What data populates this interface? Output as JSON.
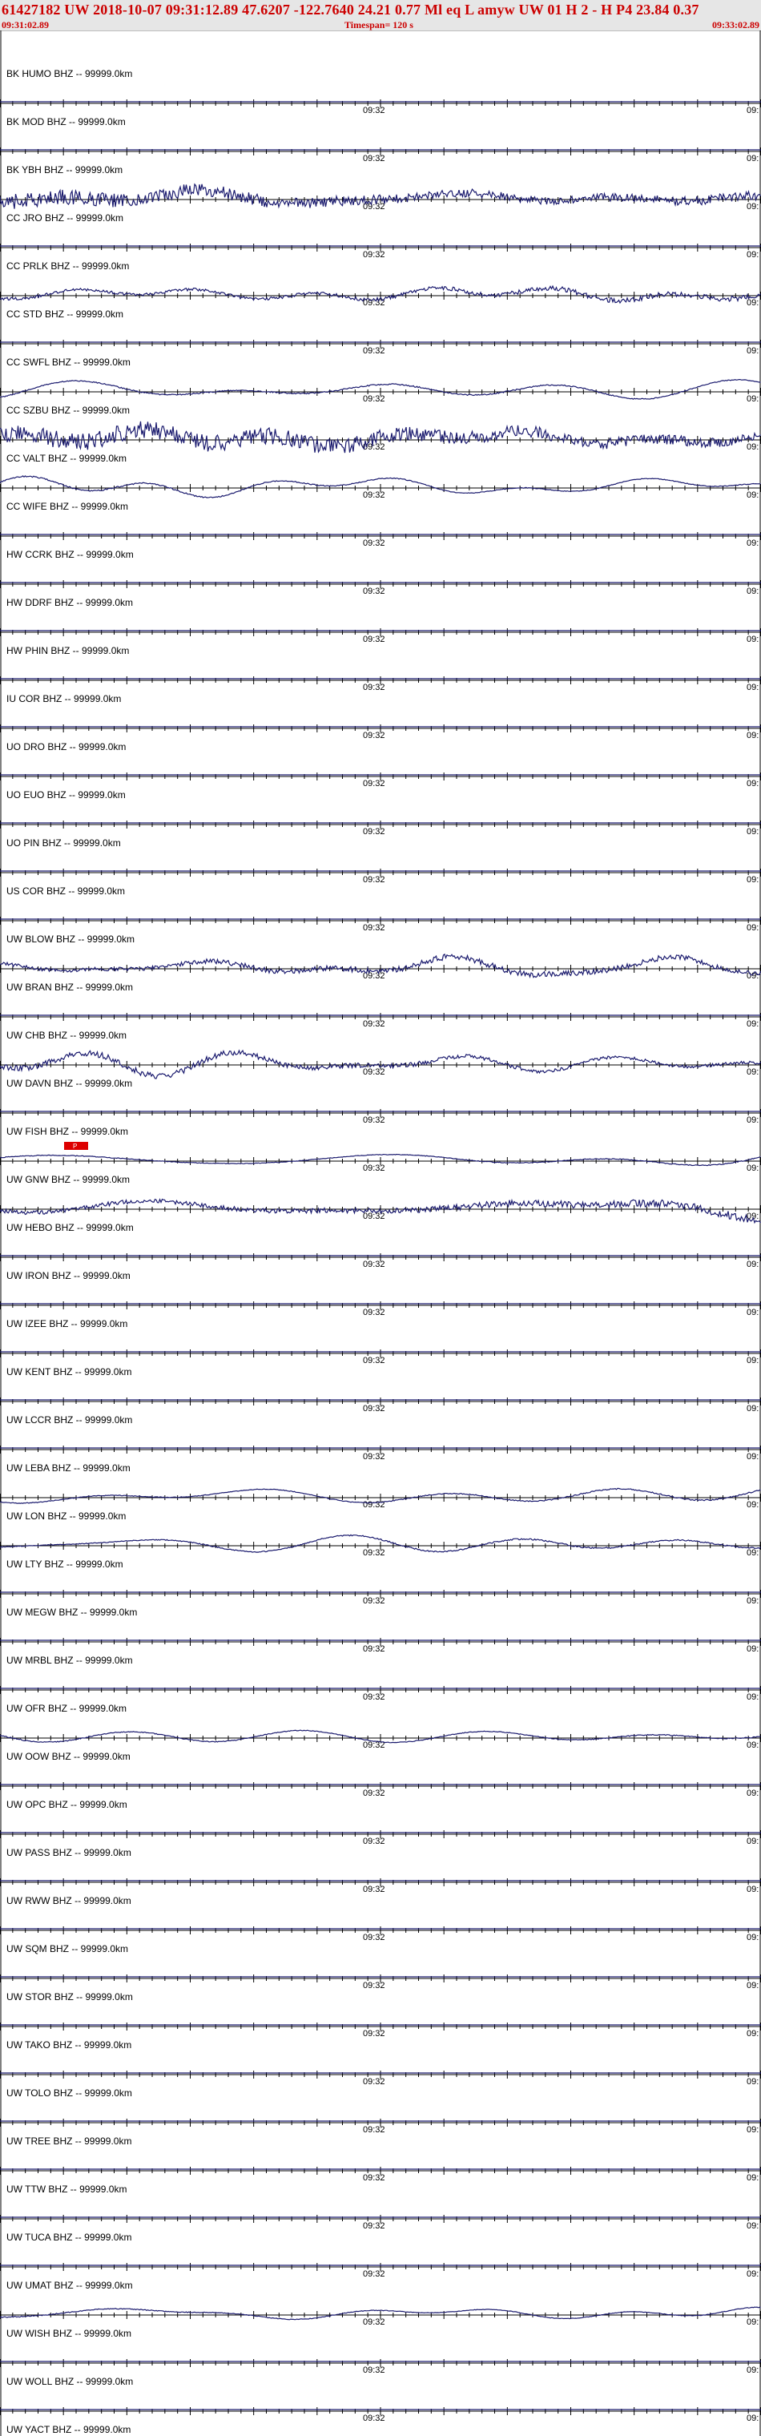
{
  "header": {
    "title": "61427182 UW 2018-10-07 09:31:12.89   47.6207 -122.7640  24.21  0.77 Ml  eq  L amyw     UW 01  H   2  -  H P4   23.84  0.37",
    "start_time": "09:31:02.89",
    "timespan": "Timespan= 120 s",
    "end_time": "09:33:02.89"
  },
  "colors": {
    "trace": "#1a1a6e",
    "axis": "#000000",
    "header_text": "#cc0000",
    "header_bg": "#e6e6e6",
    "pick": "#dd0000"
  },
  "chart_data": {
    "type": "line",
    "title": "",
    "xlabel": "",
    "ylabel": "",
    "time_label": "09:32",
    "time_label_right": "09:",
    "traces": [
      {
        "label": "BK HUMO BHZ -- 99999.0km",
        "shape": "flat",
        "amplitude": 0
      },
      {
        "label": "BK MOD BHZ -- 99999.0km",
        "shape": "flat",
        "amplitude": 0
      },
      {
        "label": "BK YBH BHZ -- 99999.0km",
        "shape": "noisy",
        "amplitude": 0.85
      },
      {
        "label": "CC JRO BHZ -- 99999.0km",
        "shape": "flat",
        "amplitude": 0
      },
      {
        "label": "CC PRLK BHZ -- 99999.0km",
        "shape": "mixed",
        "amplitude": 0.65
      },
      {
        "label": "CC STD BHZ -- 99999.0km",
        "shape": "flat",
        "amplitude": 0
      },
      {
        "label": "CC SWFL BHZ -- 99999.0km",
        "shape": "wave",
        "amplitude": 0.75
      },
      {
        "label": "CC SZBU BHZ -- 99999.0km",
        "shape": "noisy",
        "amplitude": 0.95
      },
      {
        "label": "CC VALT BHZ -- 99999.0km",
        "shape": "wave",
        "amplitude": 0.8
      },
      {
        "label": "CC WIFE BHZ -- 99999.0km",
        "shape": "flat",
        "amplitude": 0
      },
      {
        "label": "HW CCRK BHZ -- 99999.0km",
        "shape": "flat",
        "amplitude": 0
      },
      {
        "label": "HW DDRF BHZ -- 99999.0km",
        "shape": "flat",
        "amplitude": 0
      },
      {
        "label": "HW PHIN BHZ -- 99999.0km",
        "shape": "flat",
        "amplitude": 0
      },
      {
        "label": "IU COR BHZ -- 99999.0km",
        "shape": "flat",
        "amplitude": 0
      },
      {
        "label": "UO DRO BHZ -- 99999.0km",
        "shape": "flat",
        "amplitude": 0
      },
      {
        "label": "UO EUO BHZ -- 99999.0km",
        "shape": "flat",
        "amplitude": 0
      },
      {
        "label": "UO PIN BHZ -- 99999.0km",
        "shape": "flat",
        "amplitude": 0
      },
      {
        "label": "US COR BHZ -- 99999.0km",
        "shape": "flat",
        "amplitude": 0
      },
      {
        "label": "UW BLOW BHZ -- 99999.0km",
        "shape": "mixed",
        "amplitude": 0.7
      },
      {
        "label": "UW BRAN BHZ -- 99999.0km",
        "shape": "flat",
        "amplitude": 0
      },
      {
        "label": "UW CHB BHZ -- 99999.0km",
        "shape": "mixed",
        "amplitude": 0.7
      },
      {
        "label": "UW DAVN BHZ -- 99999.0km",
        "shape": "flat",
        "amplitude": 0
      },
      {
        "label": "UW FISH BHZ -- 99999.0km",
        "shape": "wave",
        "amplitude": 0.65,
        "pick": "P"
      },
      {
        "label": "UW GNW BHZ -- 99999.0km",
        "shape": "mixed",
        "amplitude": 0.95
      },
      {
        "label": "UW HEBO BHZ -- 99999.0km",
        "shape": "flat",
        "amplitude": 0
      },
      {
        "label": "UW IRON BHZ -- 99999.0km",
        "shape": "flat",
        "amplitude": 0
      },
      {
        "label": "UW IZEE BHZ -- 99999.0km",
        "shape": "flat",
        "amplitude": 0
      },
      {
        "label": "UW KENT BHZ -- 99999.0km",
        "shape": "flat",
        "amplitude": 0
      },
      {
        "label": "UW LCCR BHZ -- 99999.0km",
        "shape": "flat",
        "amplitude": 0
      },
      {
        "label": "UW LEBA BHZ -- 99999.0km",
        "shape": "wave",
        "amplitude": 0.75
      },
      {
        "label": "UW LON BHZ -- 99999.0km",
        "shape": "wave",
        "amplitude": 0.85
      },
      {
        "label": "UW LTY BHZ -- 99999.0km",
        "shape": "flat",
        "amplitude": 0
      },
      {
        "label": "UW MEGW BHZ -- 99999.0km",
        "shape": "flat",
        "amplitude": 0
      },
      {
        "label": "UW MRBL BHZ -- 99999.0km",
        "shape": "flat",
        "amplitude": 0
      },
      {
        "label": "UW OFR BHZ -- 99999.0km",
        "shape": "wave",
        "amplitude": 0.8
      },
      {
        "label": "UW OOW BHZ -- 99999.0km",
        "shape": "flat",
        "amplitude": 0
      },
      {
        "label": "UW OPC BHZ -- 99999.0km",
        "shape": "flat",
        "amplitude": 0
      },
      {
        "label": "UW PASS BHZ -- 99999.0km",
        "shape": "flat",
        "amplitude": 0
      },
      {
        "label": "UW RWW BHZ -- 99999.0km",
        "shape": "flat",
        "amplitude": 0
      },
      {
        "label": "UW SQM BHZ -- 99999.0km",
        "shape": "flat",
        "amplitude": 0
      },
      {
        "label": "UW STOR BHZ -- 99999.0km",
        "shape": "flat",
        "amplitude": 0
      },
      {
        "label": "UW TAKO BHZ -- 99999.0km",
        "shape": "flat",
        "amplitude": 0
      },
      {
        "label": "UW TOLO BHZ -- 99999.0km",
        "shape": "flat",
        "amplitude": 0
      },
      {
        "label": "UW TREE BHZ -- 99999.0km",
        "shape": "flat",
        "amplitude": 0
      },
      {
        "label": "UW TTW BHZ -- 99999.0km",
        "shape": "flat",
        "amplitude": 0
      },
      {
        "label": "UW TUCA BHZ -- 99999.0km",
        "shape": "flat",
        "amplitude": 0
      },
      {
        "label": "UW UMAT BHZ -- 99999.0km",
        "shape": "wave",
        "amplitude": 0.6
      },
      {
        "label": "UW WISH BHZ -- 99999.0km",
        "shape": "flat",
        "amplitude": 0
      },
      {
        "label": "UW WOLL BHZ -- 99999.0km",
        "shape": "flat",
        "amplitude": 0
      },
      {
        "label": "UW YACT BHZ -- 99999.0km",
        "shape": "flat",
        "amplitude": 0
      }
    ]
  }
}
